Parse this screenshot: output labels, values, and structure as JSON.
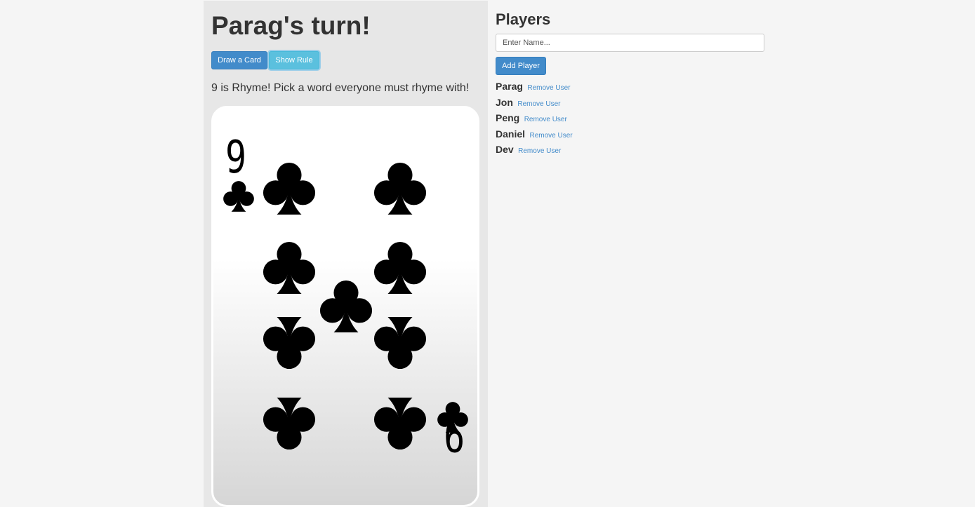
{
  "game": {
    "turn_title": "Parag's turn!",
    "draw_button": "Draw a Card",
    "rule_button": "Show Rule",
    "rule_text": "9 is Rhyme! Pick a word everyone must rhyme with!"
  },
  "card": {
    "rank": "9",
    "suit": "clubs",
    "suit_icon": "club-icon",
    "pip_count": 9,
    "ink_color": "#000000"
  },
  "players_panel": {
    "title": "Players",
    "input_placeholder": "Enter Name...",
    "input_value": "",
    "add_button": "Add Player",
    "remove_label": "Remove User",
    "players": [
      {
        "name": "Parag"
      },
      {
        "name": "Jon"
      },
      {
        "name": "Peng"
      },
      {
        "name": "Daniel"
      },
      {
        "name": "Dev"
      }
    ]
  },
  "colors": {
    "page_background": "#f5f5f5",
    "panel_background": "#e7e7e7",
    "primary": "#428bca",
    "info": "#5bc0de",
    "link": "#428bca",
    "text": "#333333"
  }
}
